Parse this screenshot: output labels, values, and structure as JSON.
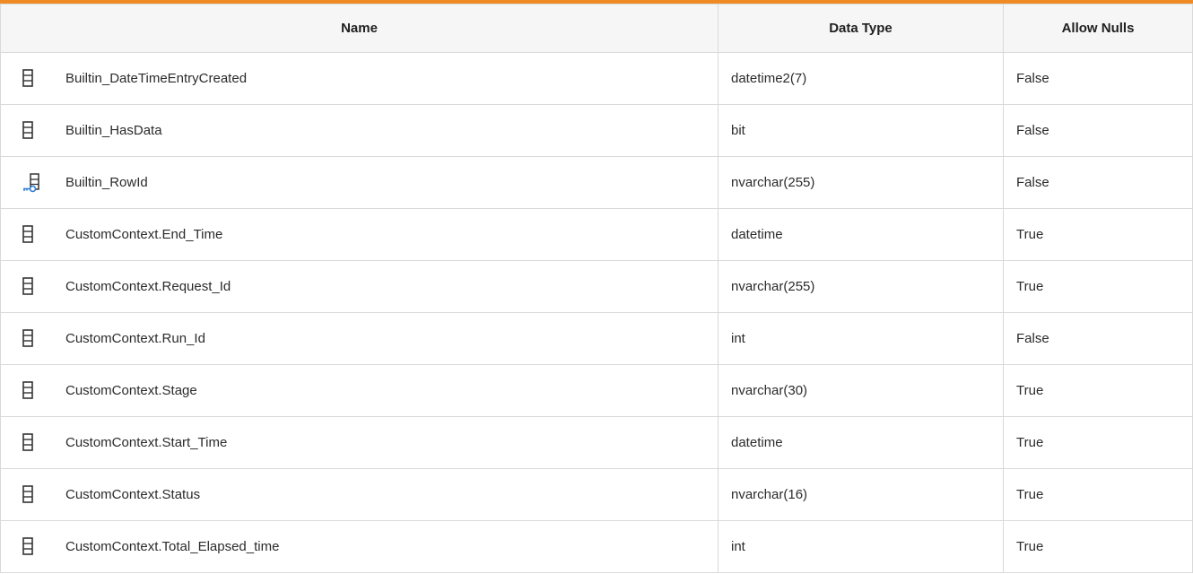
{
  "colors": {
    "accent": "#f08a24",
    "key_icon": "#2f7fd1"
  },
  "table": {
    "headers": {
      "name": "Name",
      "data_type": "Data Type",
      "allow_nulls": "Allow Nulls"
    },
    "rows": [
      {
        "icon": "column-icon",
        "name": "Builtin_DateTimeEntryCreated",
        "data_type": "datetime2(7)",
        "allow_nulls": "False"
      },
      {
        "icon": "column-icon",
        "name": "Builtin_HasData",
        "data_type": "bit",
        "allow_nulls": "False"
      },
      {
        "icon": "primary-key-column-icon",
        "name": "Builtin_RowId",
        "data_type": "nvarchar(255)",
        "allow_nulls": "False"
      },
      {
        "icon": "column-icon",
        "name": "CustomContext.End_Time",
        "data_type": "datetime",
        "allow_nulls": "True"
      },
      {
        "icon": "column-icon",
        "name": "CustomContext.Request_Id",
        "data_type": "nvarchar(255)",
        "allow_nulls": "True"
      },
      {
        "icon": "column-icon",
        "name": "CustomContext.Run_Id",
        "data_type": "int",
        "allow_nulls": "False"
      },
      {
        "icon": "column-icon",
        "name": "CustomContext.Stage",
        "data_type": "nvarchar(30)",
        "allow_nulls": "True"
      },
      {
        "icon": "column-icon",
        "name": "CustomContext.Start_Time",
        "data_type": "datetime",
        "allow_nulls": "True"
      },
      {
        "icon": "column-icon",
        "name": "CustomContext.Status",
        "data_type": "nvarchar(16)",
        "allow_nulls": "True"
      },
      {
        "icon": "column-icon",
        "name": "CustomContext.Total_Elapsed_time",
        "data_type": "int",
        "allow_nulls": "True"
      }
    ]
  }
}
